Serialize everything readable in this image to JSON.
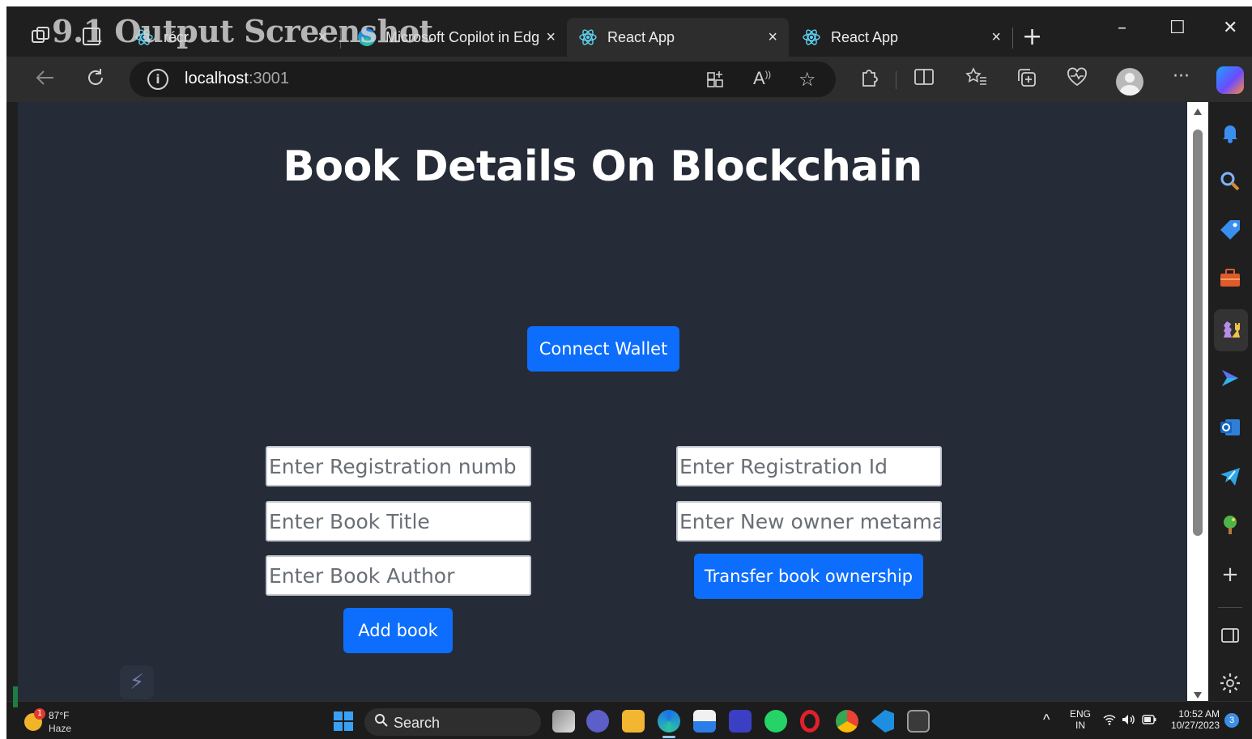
{
  "overlay_title": "9.1 Output Screenshot",
  "browser": {
    "tabs": [
      {
        "label": "récr",
        "active": false
      },
      {
        "label": "Microsoft Copilot in Edg",
        "active": false
      },
      {
        "label": "React App",
        "active": true
      },
      {
        "label": "React App",
        "active": false
      }
    ],
    "close_glyph": "×",
    "new_tab_glyph": "+",
    "window_controls": {
      "minimize": "–",
      "maximize": "☐",
      "close": "✕"
    },
    "address": {
      "host": "localhost",
      "port": ":3001"
    }
  },
  "page": {
    "title": "Book Details On Blockchain",
    "connect_wallet_label": "Connect Wallet",
    "add_form": {
      "registration_placeholder": "Enter Registration numb",
      "title_placeholder": "Enter Book Title",
      "author_placeholder": "Enter Book Author",
      "submit_label": "Add book"
    },
    "transfer_form": {
      "registration_id_placeholder": "Enter Registration Id",
      "new_owner_placeholder": "Enter New owner metama",
      "submit_label": "Transfer book ownership"
    }
  },
  "taskbar": {
    "weather": {
      "temp": "87°F",
      "condition": "Haze",
      "badge": "1"
    },
    "search_label": "Search",
    "language": {
      "line1": "ENG",
      "line2": "IN"
    },
    "time": "10:52 AM",
    "date": "10/27/2023",
    "notification_count": "3"
  },
  "colors": {
    "page_background": "#252b37",
    "primary_button": "#0d6efd",
    "browser_chrome": "#1f1f1f",
    "toolbar": "#2d2d2d"
  },
  "icons": {
    "tab_favicon": "react-icon",
    "sidebar": [
      "bell-icon",
      "search-icon",
      "tag-icon",
      "briefcase-icon",
      "chess-icon",
      "copilot-icon",
      "outlook-icon",
      "telegram-icon",
      "tree-icon",
      "plus-icon",
      "sidebar-toggle-icon",
      "gear-icon"
    ]
  }
}
